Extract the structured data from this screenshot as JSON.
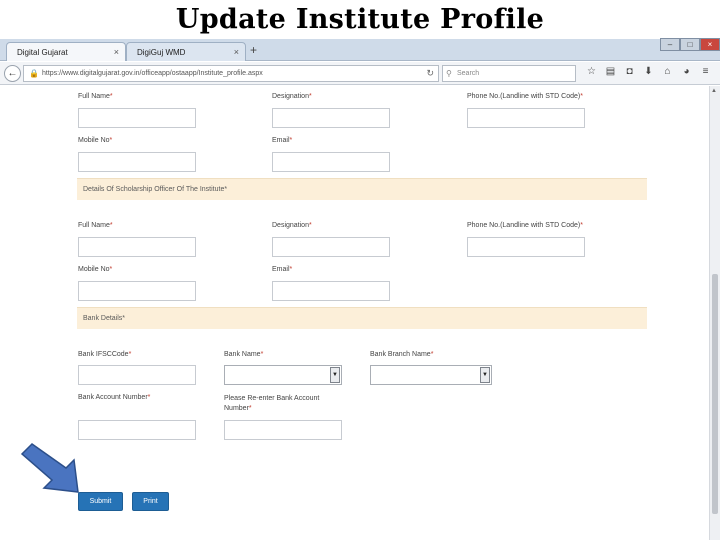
{
  "slide": {
    "title": "Update Institute Profile"
  },
  "browser": {
    "tabs": [
      {
        "label": "Digital Gujarat",
        "active": true
      },
      {
        "label": "DigiGuj WMD",
        "active": false
      }
    ],
    "new_tab_label": "+",
    "url": "https://www.digitalgujarat.gov.in/officeapp/ostaapp/Institute_profile.aspx",
    "search_placeholder": "Search"
  },
  "form": {
    "top_row1": {
      "full_name": "Full Name",
      "designation": "Designation",
      "phone": "Phone No.(Landline with STD Code)"
    },
    "top_row2": {
      "mobile": "Mobile No",
      "email": "Email"
    },
    "scholarship_section": {
      "heading": "Details Of Scholarship Officer Of The Institute*",
      "full_name": "Full Name",
      "designation": "Designation",
      "phone": "Phone No.(Landline with STD Code)",
      "mobile": "Mobile No",
      "email": "Email"
    },
    "bank_section": {
      "heading": "Bank Details*",
      "ifsc": "Bank IFSCCode",
      "bank_name": "Bank Name",
      "branch_name": "Bank Branch Name",
      "account_number": "Bank Account Number",
      "reenter_account": "Please Re-enter Bank Account Number"
    },
    "required_mark": "*",
    "buttons": {
      "submit": "Submit",
      "print": "Print"
    }
  },
  "colors": {
    "section_bg": "#fcefd9",
    "button_bg": "#2673b6",
    "pointer_arrow": "#4a74c0"
  }
}
